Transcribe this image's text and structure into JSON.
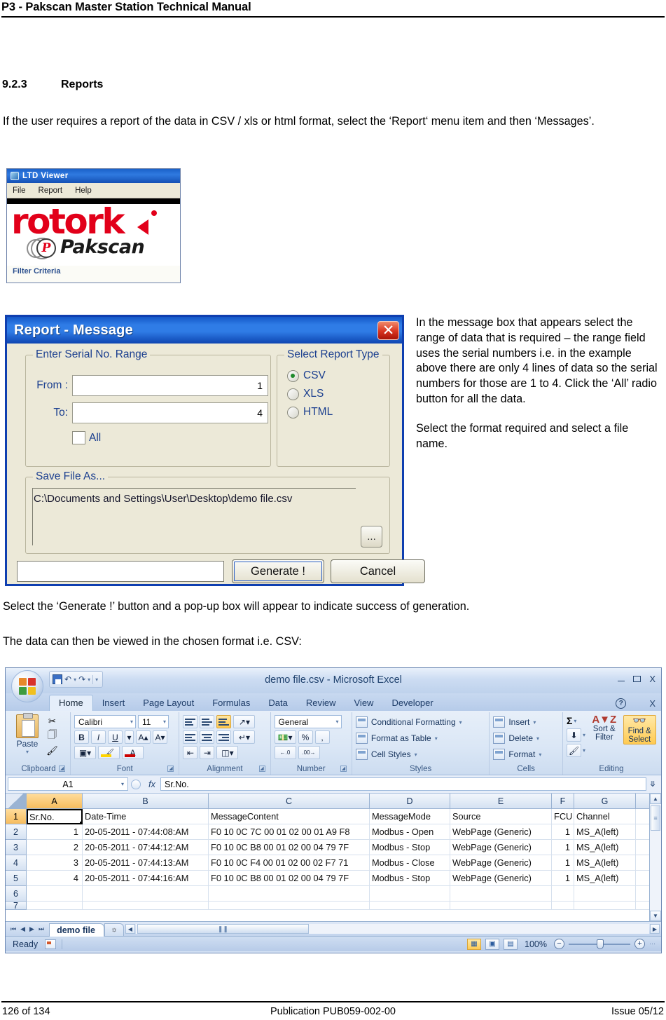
{
  "header": {
    "title": "P3 - Pakscan Master Station Technical Manual"
  },
  "section": {
    "number": "9.2.3",
    "title": "Reports",
    "intro": "If the user requires a report of the data in CSV / xls or html format, select the ‘Report‘ menu item and then ‘Messages’."
  },
  "ltd_viewer": {
    "window_title": "LTD Viewer",
    "icon": "app-icon",
    "menu": [
      "File",
      "Report",
      "Help"
    ],
    "logo_brand": "rotork",
    "logo_product": "Pakscan",
    "logo_mark": "P",
    "filter_label": "Filter Criteria"
  },
  "report_dialog": {
    "title": "Report  -  Message",
    "close_label": "✕",
    "range_group_label": "Enter Serial No. Range",
    "from_label": "From :",
    "from_value": "1",
    "to_label": "To:",
    "to_value": "4",
    "all_label": "All",
    "all_checked": false,
    "type_group_label": "Select Report Type",
    "types": [
      {
        "label": "CSV",
        "selected": true
      },
      {
        "label": "XLS",
        "selected": false
      },
      {
        "label": "HTML",
        "selected": false
      }
    ],
    "save_group_label": "Save File As...",
    "save_path": "C:\\Documents and Settings\\User\\Desktop\\demo file.csv",
    "browse_label": "...",
    "status_value": "",
    "generate_label": "Generate !",
    "cancel_label": "Cancel"
  },
  "side_notes": {
    "p1": "In the message box that appears select the range of data that is required – the range field uses the serial numbers i.e. in the example above there are only 4 lines of data so the serial numbers for those are 1 to 4.  Click the ‘All’ radio button for all the data.",
    "p2": "Select the format required and select a file name."
  },
  "body": {
    "generate_note": "Select the ‘Generate !’ button and a pop-up box will appear to indicate success of generation.",
    "csv_note": "The data can then be viewed in the chosen format i.e. CSV:"
  },
  "excel": {
    "doc_title": "demo file.csv - Microsoft Excel",
    "office_button": "office-orb",
    "quick_access": [
      "save-icon",
      "undo-icon",
      "redo-icon",
      "customize-icon"
    ],
    "window_buttons": [
      "minimize",
      "restore",
      "close"
    ],
    "window_close_label": "X",
    "tabs": [
      "Home",
      "Insert",
      "Page Layout",
      "Formulas",
      "Data",
      "Review",
      "View",
      "Developer"
    ],
    "active_tab": "Home",
    "help_label": "?",
    "ribbon": {
      "clipboard": {
        "name": "Clipboard",
        "paste": "Paste",
        "tools": [
          "cut-icon",
          "copy-icon",
          "format-painter-icon"
        ]
      },
      "font": {
        "name": "Font",
        "font_name": "Calibri",
        "font_size": "11",
        "bold": "B",
        "italic": "I",
        "underline": "U",
        "grow": "A",
        "shrink": "A",
        "borders": "borders-icon",
        "fill": "fill-color-icon",
        "fontcolor": "font-color-icon"
      },
      "alignment": {
        "name": "Alignment",
        "buttons": [
          "top-align",
          "middle-align",
          "bottom-align",
          "orientation",
          "align-left",
          "center",
          "align-right",
          "wrap-text",
          "decrease-indent",
          "increase-indent",
          "merge-center"
        ]
      },
      "number": {
        "name": "Number",
        "format": "General",
        "accounting": "accounting-icon",
        "percent": "%",
        "comma": ",",
        "increase_decimal": ".00",
        "decrease_decimal": ".00"
      },
      "styles": {
        "name": "Styles",
        "items": [
          "Conditional Formatting",
          "Format as Table",
          "Cell Styles"
        ]
      },
      "cells": {
        "name": "Cells",
        "items": [
          "Insert",
          "Delete",
          "Format"
        ]
      },
      "editing": {
        "name": "Editing",
        "autosum": "Σ",
        "fill": "fill-icon",
        "clear": "clear-icon",
        "sort_filter": "Sort &\nFilter",
        "sort_filter_l1": "Sort &",
        "sort_filter_l2": "Filter",
        "find_select_l1": "Find &",
        "find_select_l2": "Select"
      }
    },
    "name_box": "A1",
    "formula_bar": "Sr.No.",
    "columns": [
      "A",
      "B",
      "C",
      "D",
      "E",
      "F",
      "G"
    ],
    "selected_column": "A",
    "rows": [
      "1",
      "2",
      "3",
      "4",
      "5",
      "6",
      "7"
    ],
    "selected_row": "1",
    "sheet_data": [
      [
        "Sr.No.",
        "Date-Time",
        "MessageContent",
        "MessageMode",
        "Source",
        "FCU",
        "Channel"
      ],
      [
        "1",
        "20-05-2011 - 07:44:08:AM",
        "F0 10 0C 7C 00 01 02 00 01 A9 F8",
        "Modbus - Open",
        "WebPage (Generic)",
        "1",
        "MS_A(left)"
      ],
      [
        "2",
        "20-05-2011 - 07:44:12:AM",
        "F0 10 0C B8 00 01 02 00 04 79 7F",
        "Modbus - Stop",
        "WebPage (Generic)",
        "1",
        "MS_A(left)"
      ],
      [
        "3",
        "20-05-2011 - 07:44:13:AM",
        "F0 10 0C F4 00 01 02 00 02 F7 71",
        "Modbus - Close",
        "WebPage (Generic)",
        "1",
        "MS_A(left)"
      ],
      [
        "4",
        "20-05-2011 - 07:44:16:AM",
        "F0 10 0C B8 00 01 02 00 04 79 7F",
        "Modbus - Stop",
        "WebPage (Generic)",
        "1",
        "MS_A(left)"
      ],
      [
        "",
        "",
        "",
        "",
        "",
        "",
        ""
      ],
      [
        "",
        "",
        "",
        "",
        "",
        "",
        ""
      ]
    ],
    "sheet_tab": "demo file",
    "insert_sheet_label": "+",
    "status": "Ready",
    "zoom": "100%",
    "view_buttons": [
      "normal-view",
      "page-layout-view",
      "page-break-view"
    ]
  },
  "footer": {
    "left": "126 of 134",
    "center": "Publication PUB059-002-00",
    "right": "Issue 05/12"
  }
}
